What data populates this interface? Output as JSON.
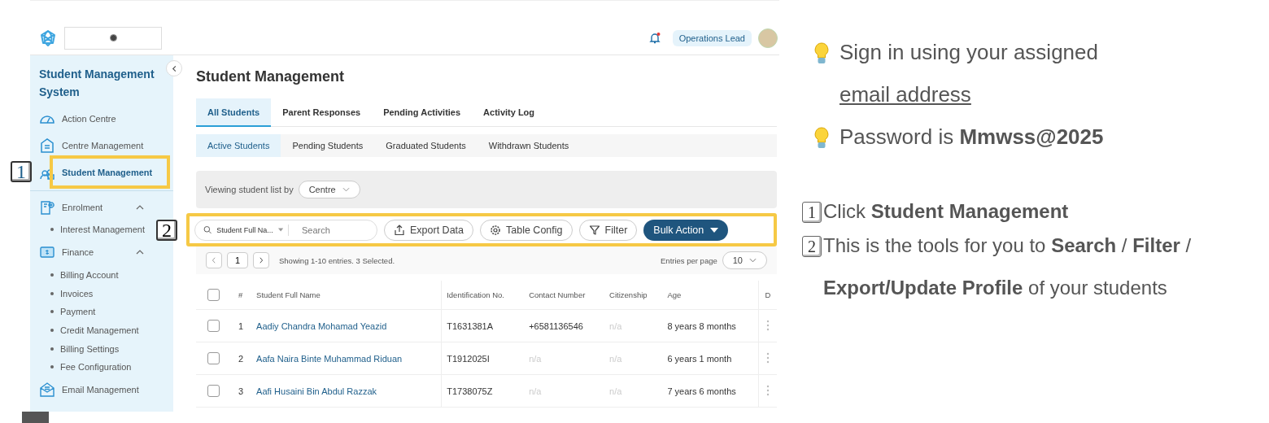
{
  "topbar": {
    "role": "Operations Lead",
    "notification": true
  },
  "sidebar": {
    "title": "Student Management System",
    "sections": [
      [
        {
          "kind": "link",
          "label": "Action Centre",
          "selected": false
        },
        {
          "kind": "link",
          "label": "Centre Management",
          "selected": false
        },
        {
          "kind": "link",
          "label": "Student Management",
          "selected": true
        }
      ],
      [
        {
          "kind": "group",
          "label": "Enrolment",
          "expanded": true,
          "children": [
            {
              "label": "Interest Management"
            }
          ]
        },
        {
          "kind": "group",
          "label": "Finance",
          "expanded": true,
          "children": [
            {
              "label": "Billing Account"
            },
            {
              "label": "Invoices"
            },
            {
              "label": "Payment"
            },
            {
              "label": "Credit Management"
            },
            {
              "label": "Billing Settings"
            },
            {
              "label": "Fee Configuration"
            }
          ]
        },
        {
          "kind": "link",
          "label": "Email Management",
          "selected": false
        }
      ]
    ]
  },
  "page_title": "Student Management",
  "tabs": [
    {
      "label": "All Students",
      "selected": true
    },
    {
      "label": "Parent Responses",
      "selected": false
    },
    {
      "label": "Pending Activities",
      "selected": false
    },
    {
      "label": "Activity Log",
      "selected": false
    }
  ],
  "subtabs": [
    {
      "label": "Active Students",
      "selected": true
    },
    {
      "label": "Pending Students",
      "selected": false
    },
    {
      "label": "Graduated Students",
      "selected": false
    },
    {
      "label": "Withdrawn Students",
      "selected": false
    }
  ],
  "view_by": {
    "label": "Viewing student list by",
    "value": "Centre"
  },
  "toolbar": {
    "search_scope": "Student Full Na...",
    "placeholder": "Search",
    "buttons": [
      {
        "kind": "export",
        "label": "Export Data"
      },
      {
        "kind": "config",
        "label": "Table Config"
      },
      {
        "kind": "filter",
        "label": "Filter"
      }
    ],
    "bulk_action": "Bulk Action"
  },
  "pagination": {
    "page": "1",
    "summary": "Showing 1-10 entries. 3 Selected.",
    "per_page_label": "Entries per page",
    "per_page": "10"
  },
  "table": {
    "header_checked": false,
    "columns": [
      "#",
      "Student Full Name",
      "Identification No.",
      "Contact Number",
      "Citizenship",
      "Age",
      "D"
    ],
    "rows": [
      {
        "checked": false,
        "num": "1",
        "name": "Aadiy Chandra Mohamad Yeazid",
        "id": "T1631381A",
        "contact": {
          "text": "+6581136546",
          "muted": false
        },
        "citizenship": {
          "text": "n/a",
          "muted": true
        },
        "age": "8 years 8 months"
      },
      {
        "checked": false,
        "num": "2",
        "name": "Aafa Naira Binte Muhammad Riduan",
        "id": "T1912025I",
        "contact": {
          "text": "n/a",
          "muted": true
        },
        "citizenship": {
          "text": "n/a",
          "muted": true
        },
        "age": "6 years 1 month"
      },
      {
        "checked": false,
        "num": "3",
        "name": "Aafi Husaini Bin Abdul Razzak",
        "id": "T1738075Z",
        "contact": {
          "text": "n/a",
          "muted": true
        },
        "citizenship": {
          "text": "n/a",
          "muted": true
        },
        "age": "7 years 6 months"
      }
    ]
  },
  "callouts": [
    {
      "label": "1"
    },
    {
      "label": "2"
    }
  ],
  "notes": {
    "tips": [
      {
        "text": "Sign in using your assigned",
        "link": "email address"
      },
      {
        "text": "Password is **Mmwss@2025**"
      }
    ],
    "steps": [
      {
        "badge": "1",
        "text": "Click **Student Management**"
      },
      {
        "badge": "2",
        "text": "This is the tools for you to **Search** / **Filter** / **Export/Update Profile** of your students"
      }
    ]
  }
}
